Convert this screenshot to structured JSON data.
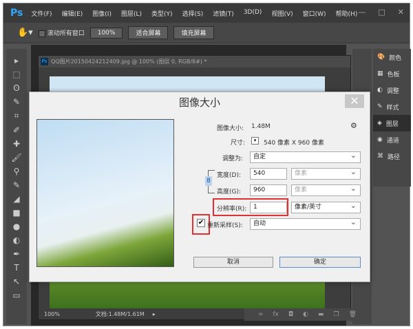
{
  "app": {
    "logo": "Ps",
    "menu": [
      "文件(F)",
      "编辑(E)",
      "图像(I)",
      "图层(L)",
      "类型(Y)",
      "选择(S)",
      "滤镜(T)",
      "3D(D)",
      "视图(V)",
      "窗口(W)",
      "帮助(H)"
    ],
    "window_controls": [
      "—",
      "□",
      "✕"
    ]
  },
  "options": {
    "scroll_all": "滚动所有窗口",
    "zoom_100": "100%",
    "fit_screen": "适合屏幕",
    "fill_screen": "填充屏幕"
  },
  "tools": [
    "▸",
    "⬚",
    "ʘ",
    "✎",
    "⌗",
    "✐",
    "✚",
    "🖌",
    "⚲",
    "✎",
    "◢",
    "■",
    "●",
    "◐",
    "✒",
    "T",
    "↖",
    "▭"
  ],
  "document": {
    "title": "QQ图片20150424212409.jpg @ 100% (图层 0, RGB/8#) *",
    "zoom": "100%",
    "doc_size": "文档:1.48M/1.61M"
  },
  "panels": [
    {
      "icon": "🎨",
      "label": "颜色"
    },
    {
      "icon": "▦",
      "label": "色板"
    },
    {
      "icon": "◐",
      "label": "调整"
    },
    {
      "icon": "✎",
      "label": "样式"
    },
    {
      "icon": "◈",
      "label": "图层"
    },
    {
      "icon": "◉",
      "label": "通道"
    },
    {
      "icon": "⌘",
      "label": "路径"
    }
  ],
  "layer_bar": [
    "∞",
    "fx",
    "◘",
    "◐",
    "▬",
    "❐",
    "🗑"
  ],
  "dialog": {
    "title": "图像大小",
    "close": "✕",
    "image_size_label": "图像大小:",
    "image_size_value": "1.48M",
    "gear": "⚙",
    "dimensions_label": "尺寸:",
    "dimensions_value": "540 像素  X  960 像素",
    "fit_to_label": "调整为:",
    "fit_to_value": "自定",
    "width_label": "宽度(D):",
    "width_value": "540",
    "width_unit": "像素",
    "height_label": "高度(G):",
    "height_value": "960",
    "height_unit": "像素",
    "resolution_label": "分辨率(R):",
    "resolution_value": "1",
    "resolution_unit": "像素/英寸",
    "resample_label": "重新采样(S):",
    "resample_value": "自动",
    "resample_checked": true,
    "cancel": "取消",
    "ok": "确定"
  }
}
